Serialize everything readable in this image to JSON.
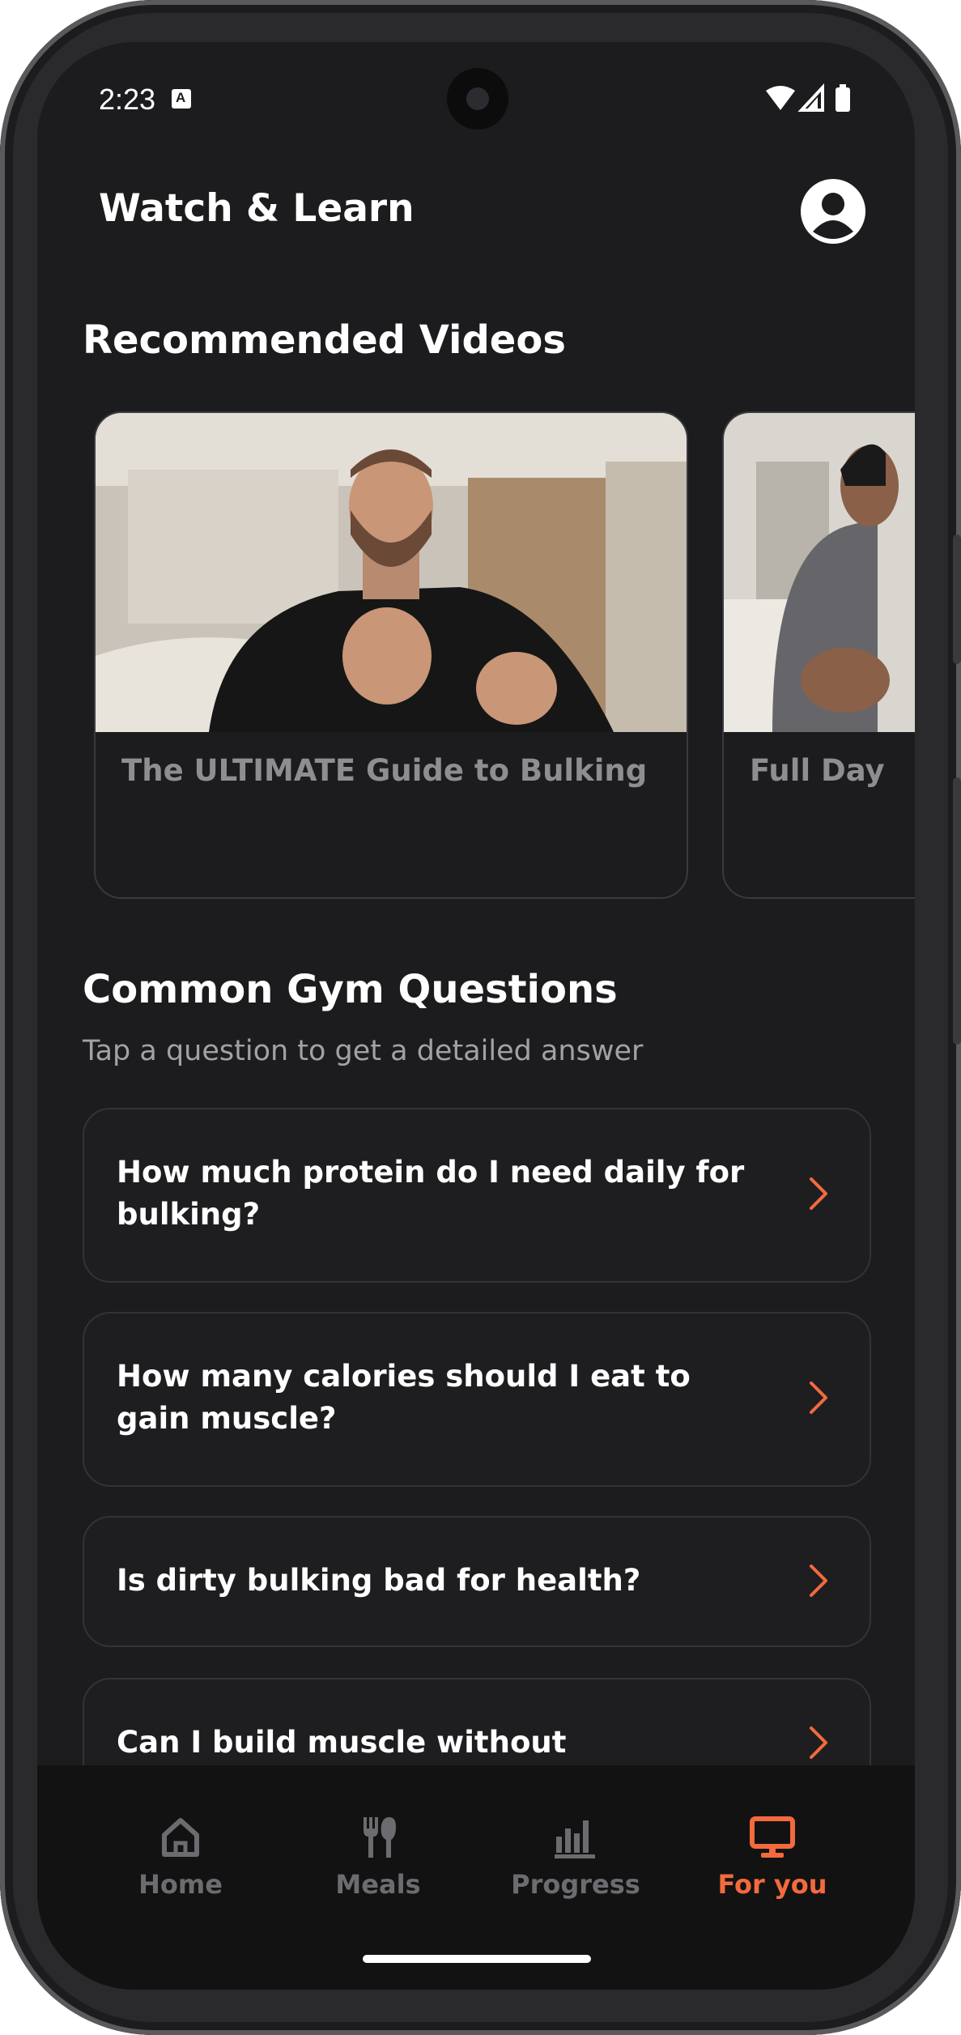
{
  "status_bar": {
    "time": "2:23"
  },
  "header": {
    "title": "Watch & Learn"
  },
  "recommended": {
    "title": "Recommended Videos",
    "videos": [
      {
        "title": "The ULTIMATE Guide to Bulking"
      },
      {
        "title": "Full Day"
      }
    ]
  },
  "questions": {
    "title": "Common Gym Questions",
    "subtitle": "Tap a question to get a detailed answer",
    "items": [
      {
        "text": "How much protein do I need daily for bulking?"
      },
      {
        "text": "How many calories should I eat to gain muscle?"
      },
      {
        "text": "Is dirty bulking bad for health?"
      },
      {
        "text": "Can I build muscle without supplements?"
      }
    ]
  },
  "nav": {
    "items": [
      {
        "label": "Home",
        "icon": "home-icon"
      },
      {
        "label": "Meals",
        "icon": "utensils-icon"
      },
      {
        "label": "Progress",
        "icon": "bar-chart-icon"
      },
      {
        "label": "For you",
        "icon": "monitor-icon",
        "active": true
      }
    ]
  },
  "colors": {
    "accent": "#f26a3d",
    "background": "#1c1c1e",
    "card": "#1e1e20",
    "inactive": "#6c6c70"
  }
}
